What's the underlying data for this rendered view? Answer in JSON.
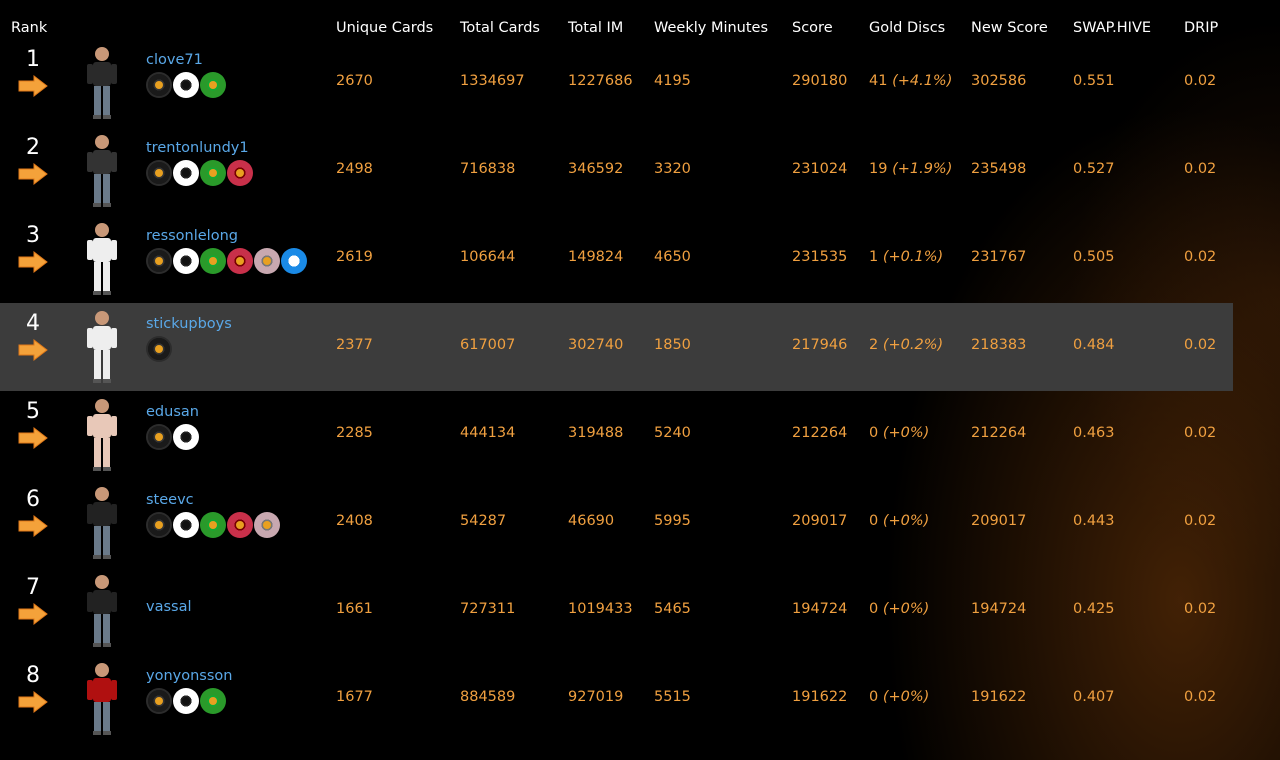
{
  "headers": {
    "rank": "Rank",
    "unique_cards": "Unique Cards",
    "total_cards": "Total Cards",
    "total_im": "Total IM",
    "weekly_minutes": "Weekly Minutes",
    "score": "Score",
    "gold_discs": "Gold Discs",
    "new_score": "New Score",
    "swap_hive": "SWAP.HIVE",
    "drip": "DRIP"
  },
  "colors": {
    "username": "#5aa8e8",
    "value": "#f0a040",
    "highlight_row": "#3c3c3c",
    "arrow": "#f4a23a"
  },
  "rows": [
    {
      "rank": "1",
      "username": "clove71",
      "discs": [
        "black",
        "white",
        "green"
      ],
      "unique_cards": "2670",
      "total_cards": "1334697",
      "total_im": "1227686",
      "weekly_minutes": "4195",
      "score": "290180",
      "gold_discs": "41",
      "gold_pct": "(+4.1%)",
      "new_score": "302586",
      "swap_hive": "0.551",
      "drip": "0.02",
      "highlight": false
    },
    {
      "rank": "2",
      "username": "trentonlundy1",
      "discs": [
        "black",
        "white",
        "green",
        "red"
      ],
      "unique_cards": "2498",
      "total_cards": "716838",
      "total_im": "346592",
      "weekly_minutes": "3320",
      "score": "231024",
      "gold_discs": "19",
      "gold_pct": "(+1.9%)",
      "new_score": "235498",
      "swap_hive": "0.527",
      "drip": "0.02",
      "highlight": false
    },
    {
      "rank": "3",
      "username": "ressonlelong",
      "discs": [
        "black",
        "white",
        "green",
        "red",
        "pink",
        "blue"
      ],
      "unique_cards": "2619",
      "total_cards": "106644",
      "total_im": "149824",
      "weekly_minutes": "4650",
      "score": "231535",
      "gold_discs": "1",
      "gold_pct": "(+0.1%)",
      "new_score": "231767",
      "swap_hive": "0.505",
      "drip": "0.02",
      "highlight": false
    },
    {
      "rank": "4",
      "username": "stickupboys",
      "discs": [
        "black"
      ],
      "unique_cards": "2377",
      "total_cards": "617007",
      "total_im": "302740",
      "weekly_minutes": "1850",
      "score": "217946",
      "gold_discs": "2",
      "gold_pct": "(+0.2%)",
      "new_score": "218383",
      "swap_hive": "0.484",
      "drip": "0.02",
      "highlight": true
    },
    {
      "rank": "5",
      "username": "edusan",
      "discs": [
        "black",
        "white"
      ],
      "unique_cards": "2285",
      "total_cards": "444134",
      "total_im": "319488",
      "weekly_minutes": "5240",
      "score": "212264",
      "gold_discs": "0",
      "gold_pct": "(+0%)",
      "new_score": "212264",
      "swap_hive": "0.463",
      "drip": "0.02",
      "highlight": false
    },
    {
      "rank": "6",
      "username": "steevc",
      "discs": [
        "black",
        "white",
        "green",
        "red",
        "pink"
      ],
      "unique_cards": "2408",
      "total_cards": "54287",
      "total_im": "46690",
      "weekly_minutes": "5995",
      "score": "209017",
      "gold_discs": "0",
      "gold_pct": "(+0%)",
      "new_score": "209017",
      "swap_hive": "0.443",
      "drip": "0.02",
      "highlight": false
    },
    {
      "rank": "7",
      "username": "vassal",
      "discs": [],
      "unique_cards": "1661",
      "total_cards": "727311",
      "total_im": "1019433",
      "weekly_minutes": "5465",
      "score": "194724",
      "gold_discs": "0",
      "gold_pct": "(+0%)",
      "new_score": "194724",
      "swap_hive": "0.425",
      "drip": "0.02",
      "highlight": false
    },
    {
      "rank": "8",
      "username": "yonyonsson",
      "discs": [
        "black",
        "white",
        "green"
      ],
      "unique_cards": "1677",
      "total_cards": "884589",
      "total_im": "927019",
      "weekly_minutes": "5515",
      "score": "191622",
      "gold_discs": "0",
      "gold_pct": "(+0%)",
      "new_score": "191622",
      "swap_hive": "0.407",
      "drip": "0.02",
      "highlight": false
    }
  ]
}
